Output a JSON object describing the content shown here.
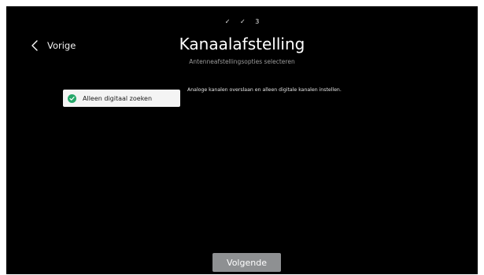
{
  "steps": {
    "items": [
      "✓",
      "✓",
      "3"
    ]
  },
  "header": {
    "back_label": "Vorige",
    "title": "Kanaalafstelling",
    "subtitle": "Antenneafstellingsopties selecteren"
  },
  "options": {
    "selected_label": "Alleen digitaal zoeken",
    "description": "Analoge kanalen overslaan en alleen digitale kanalen instellen."
  },
  "footer": {
    "next_label": "Volgende"
  },
  "icons": {
    "back": "chevron-left-icon",
    "option_state": "check-circle-icon",
    "step_done": "checkmark-icon"
  },
  "colors": {
    "background": "#000000",
    "option_bg": "#f4f4f4",
    "check_green": "#26a86a",
    "next_button": "#8e9092"
  }
}
